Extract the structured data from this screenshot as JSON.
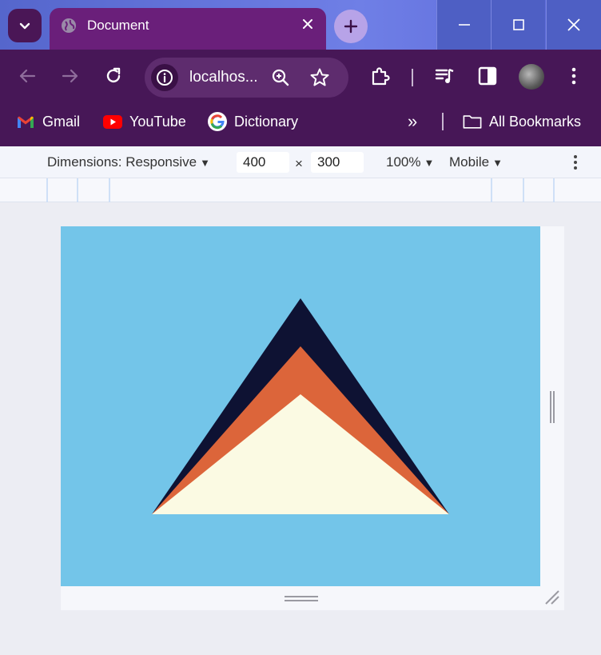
{
  "tab": {
    "title": "Document"
  },
  "omnibox": {
    "url": "localhos..."
  },
  "bookmarks": [
    {
      "label": "Gmail",
      "icon": "gmail-icon"
    },
    {
      "label": "YouTube",
      "icon": "youtube-icon"
    },
    {
      "label": "Dictionary",
      "icon": "google-icon"
    }
  ],
  "bookmarks_overflow": "»",
  "all_bookmarks": "All Bookmarks",
  "devtools": {
    "dimensions_label": "Dimensions: Responsive",
    "width": "400",
    "height": "300",
    "times": "×",
    "zoom": "100%",
    "device_mode": "Mobile"
  },
  "colors": {
    "canvas_bg": "#73c5e9",
    "triangle_outer": "#0e1233",
    "triangle_middle": "#dc653a",
    "triangle_inner": "#fbfae3"
  }
}
